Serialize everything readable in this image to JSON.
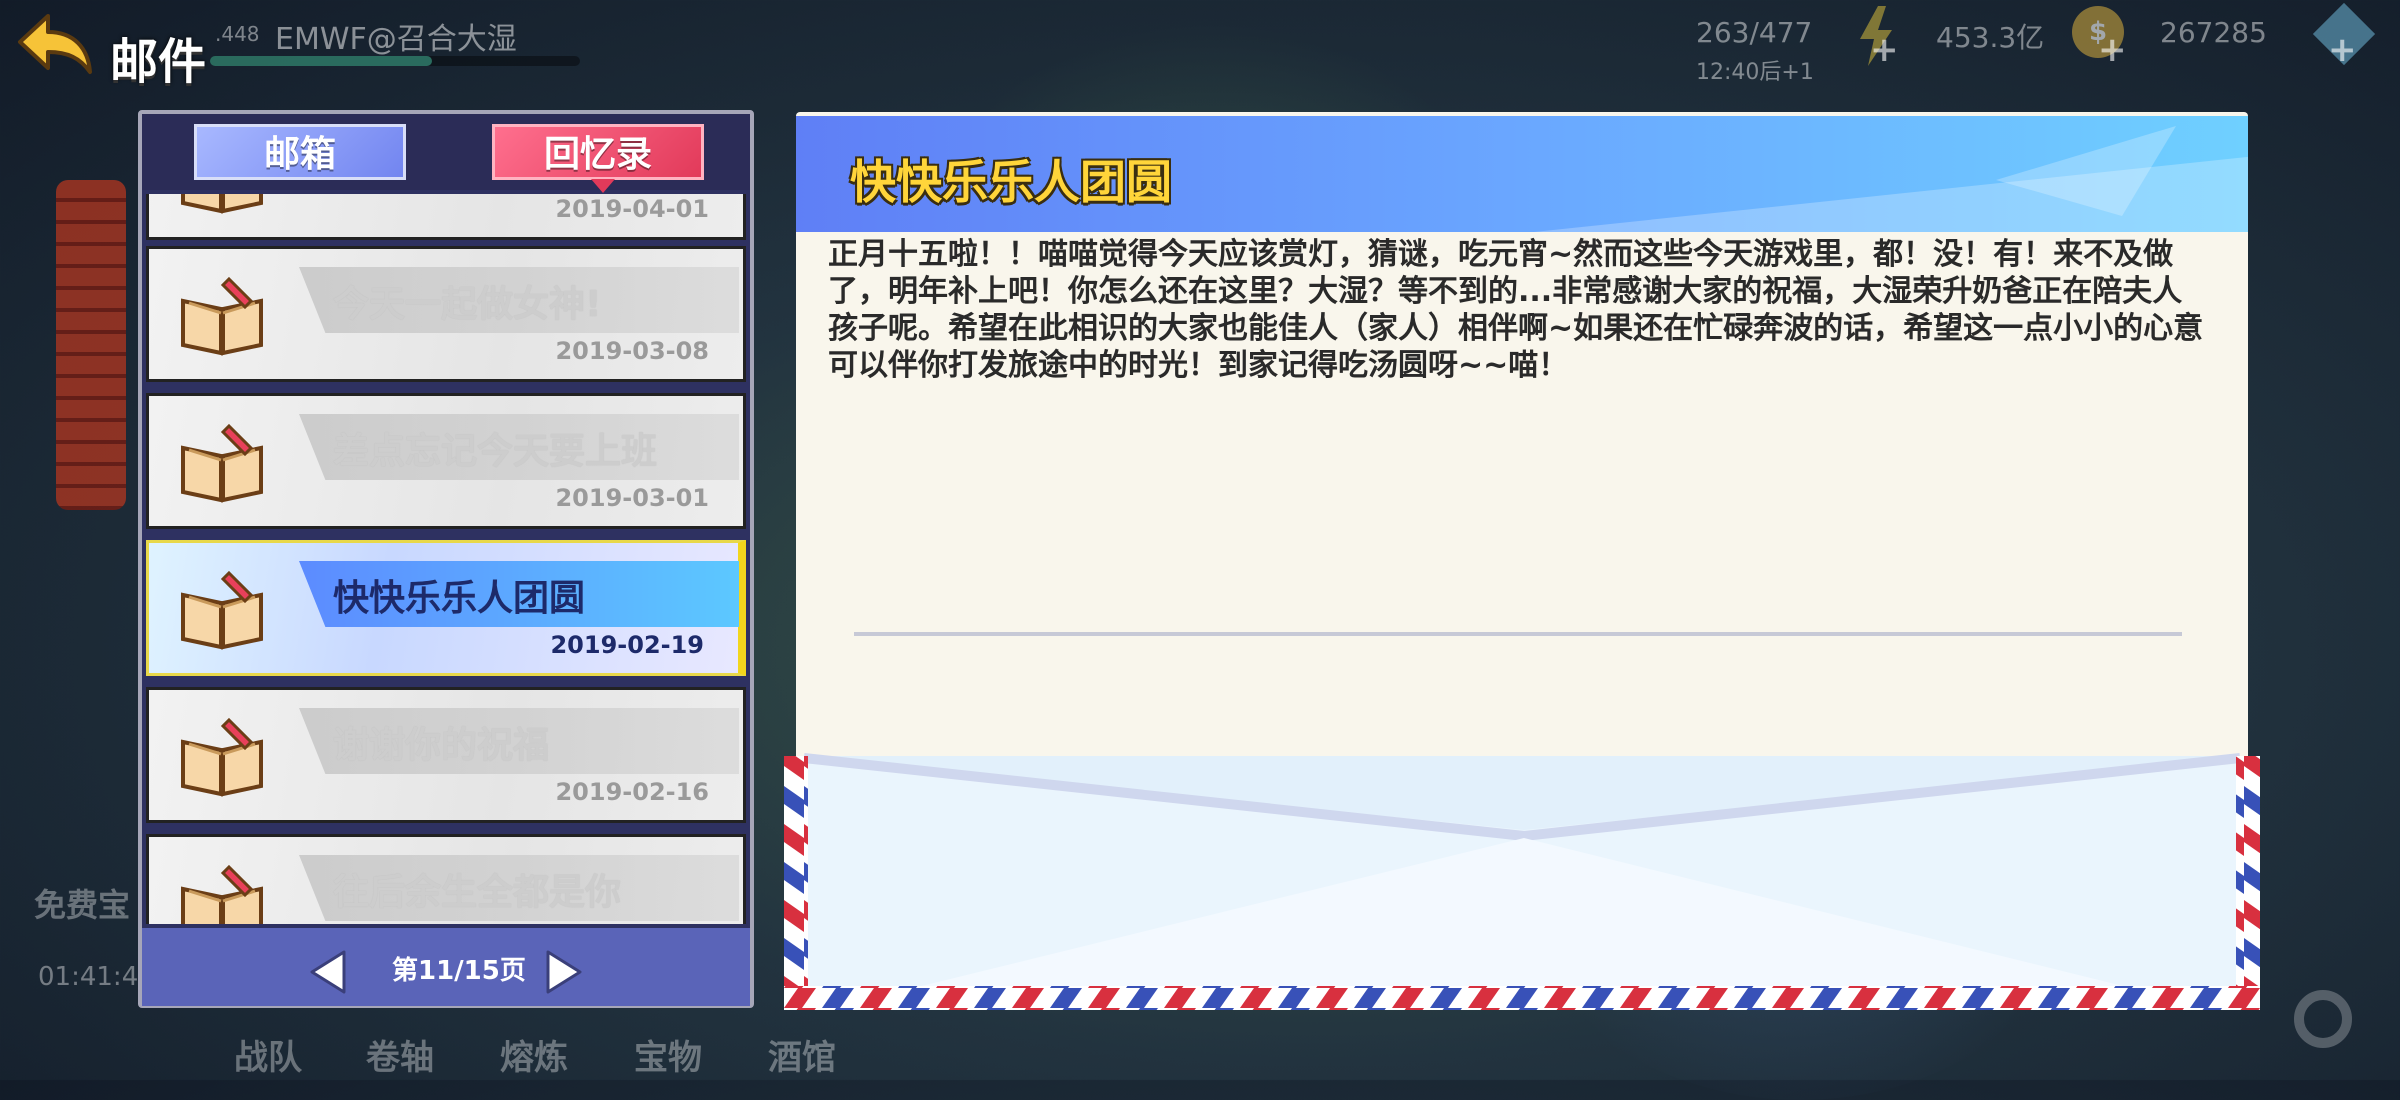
{
  "header": {
    "title": "邮件",
    "player_prefix": ".448",
    "player_name": "EMWF@召合大湿",
    "xp_fraction": 0.6
  },
  "resources": {
    "stamina": "263/477",
    "stamina_timer": "12:40后+1",
    "gold": "453.3亿",
    "coins": "267285",
    "coin_symbol": "$"
  },
  "tabs": {
    "inbox_label": "邮箱",
    "memory_label": "回忆录",
    "active": "memory"
  },
  "mail_list": [
    {
      "subject": "",
      "date": "2019-04-01",
      "selected": false
    },
    {
      "subject": "今天一起做女神!",
      "date": "2019-03-08",
      "selected": false
    },
    {
      "subject": "差点忘记今天要上班",
      "date": "2019-03-01",
      "selected": false
    },
    {
      "subject": "快快乐乐人团圆",
      "date": "2019-02-19",
      "selected": true
    },
    {
      "subject": "谢谢你的祝福",
      "date": "2019-02-16",
      "selected": false
    },
    {
      "subject": "往后余生全都是你",
      "date": "",
      "selected": false
    }
  ],
  "pager": {
    "text": "第11/15页"
  },
  "letter": {
    "title": "快快乐乐人团圆",
    "body": "正月十五啦！！喵喵觉得今天应该赏灯，猜谜，吃元宵~然而这些今天游戏里，都！没！有！来不及做了，明年补上吧！你怎么还在这里？大湿？等不到的...非常感谢大家的祝福，大湿荣升奶爸正在陪夫人孩子呢。希望在此相识的大家也能佳人（家人）相伴啊~如果还在忙碌奔波的话，希望这一点小小的心意可以伴你打发旅途中的时光！到家记得吃汤圆呀~~喵！"
  },
  "background": {
    "free_label": "免费宝",
    "timer": "01:41:4",
    "nav_items": [
      "战队",
      "卷轴",
      "熔炼",
      "宝物",
      "酒馆"
    ]
  },
  "colors": {
    "panel_bg": "#2e3161",
    "tab_inbox": "#7285f0",
    "tab_memory": "#e23a5a",
    "selected_band": "#5c8bff",
    "letter_title": "#ffd53a",
    "pager_bg": "#5a64b8"
  }
}
